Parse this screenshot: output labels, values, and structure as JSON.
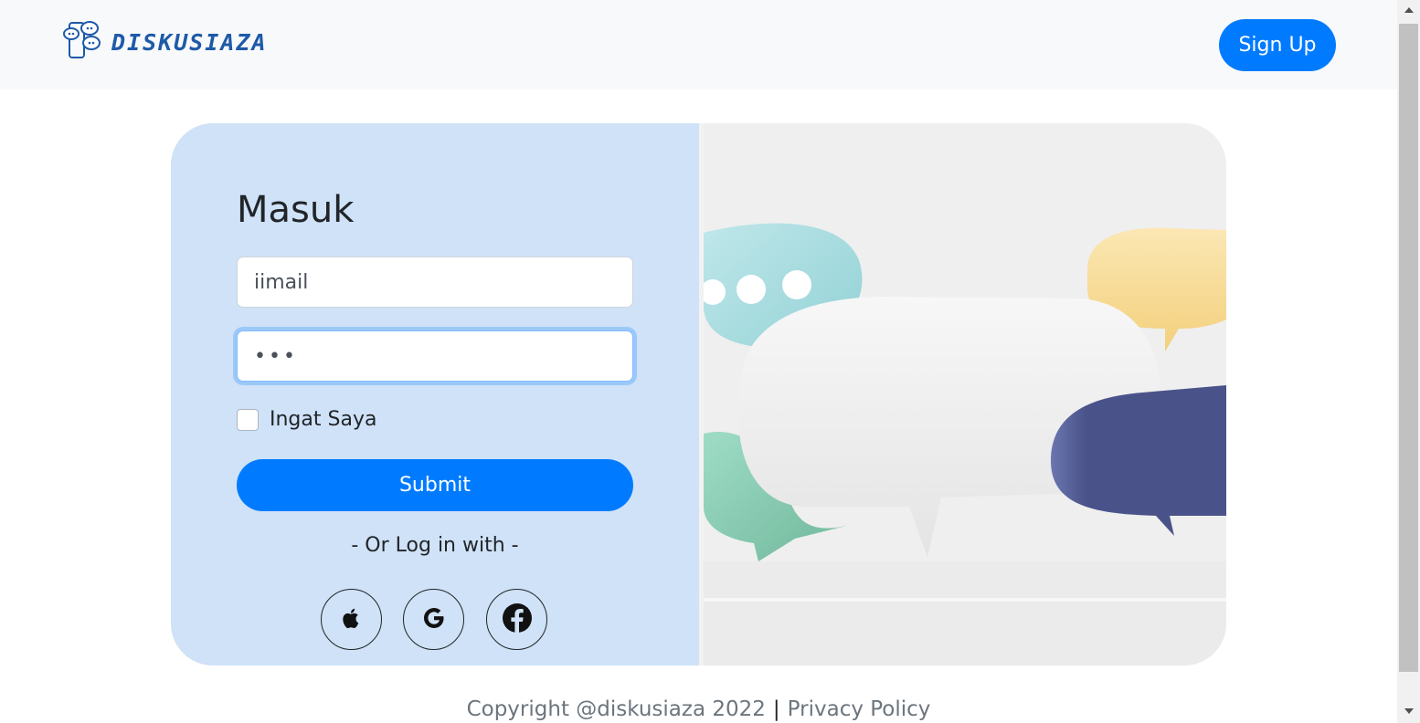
{
  "navbar": {
    "brand": "DISKUSIAZA",
    "signup_label": "Sign Up"
  },
  "login": {
    "title": "Masuk",
    "email_value": "iimail",
    "password_value": "•••",
    "remember_label": "Ingat Saya",
    "submit_label": "Submit",
    "or_text": "- Or Log in with -"
  },
  "social": {
    "icons": [
      "apple-icon",
      "google-icon",
      "facebook-icon"
    ]
  },
  "footer": {
    "copyright": "Copyright @diskusiaza 2022",
    "separator": "|",
    "privacy": "Privacy Policy"
  },
  "colors": {
    "accent": "#007bff",
    "form_bg": "#cfe2f7",
    "brand": "#1e5aa8"
  }
}
